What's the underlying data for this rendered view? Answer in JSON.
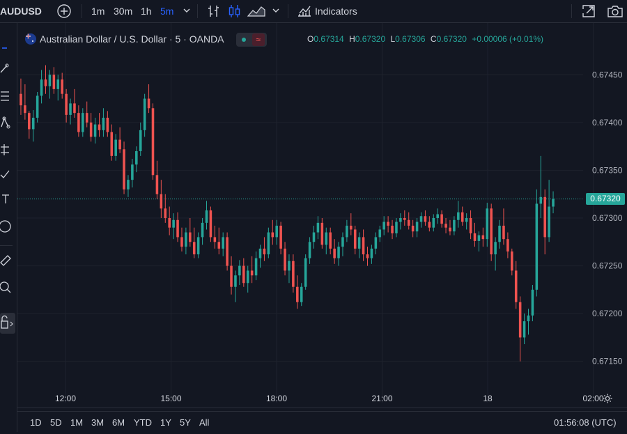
{
  "toolbar": {
    "symbol": "AUDUSD",
    "intervals": [
      "1m",
      "30m",
      "1h",
      "5m"
    ],
    "active_interval": "5m",
    "indicators_label": "Indicators"
  },
  "legend": {
    "title": "Australian Dollar / U.S. Dollar · 5 · OANDA",
    "ohlc": {
      "o_label": "O",
      "o": "0.67314",
      "h_label": "H",
      "h": "0.67320",
      "l_label": "L",
      "l": "0.67306",
      "c_label": "C",
      "c": "0.67320",
      "change": "+0.00006 (+0.01%)"
    }
  },
  "bottom": {
    "ranges": [
      "1D",
      "5D",
      "1M",
      "3M",
      "6M",
      "YTD",
      "1Y",
      "5Y",
      "All"
    ],
    "clock": "01:56:08 (UTC)"
  },
  "colors": {
    "up": "#26a69a",
    "down": "#ef5350",
    "bg": "#131722",
    "grid": "#1e222d",
    "accent": "#2962ff"
  },
  "chart_data": {
    "type": "candlestick",
    "y_ticks": [
      "0.67450",
      "0.67400",
      "0.67350",
      "0.67300",
      "0.67250",
      "0.67200",
      "0.67150"
    ],
    "y_range": [
      0.67125,
      0.67475
    ],
    "x_ticks": [
      "12:00",
      "15:00",
      "18:00",
      "21:00",
      "18",
      "02:00"
    ],
    "last_price": "0.67320",
    "last_price_value": 0.6732,
    "candles": [
      [
        0.6743,
        0.67446,
        0.67408,
        0.67418
      ],
      [
        0.67418,
        0.6744,
        0.67403,
        0.6741
      ],
      [
        0.6741,
        0.67412,
        0.67383,
        0.67393
      ],
      [
        0.67393,
        0.67413,
        0.6738,
        0.67405
      ],
      [
        0.67405,
        0.67432,
        0.674,
        0.67428
      ],
      [
        0.67428,
        0.67455,
        0.6742,
        0.67445
      ],
      [
        0.67445,
        0.6746,
        0.6743,
        0.67438
      ],
      [
        0.67438,
        0.67455,
        0.67425,
        0.6745
      ],
      [
        0.6745,
        0.67458,
        0.6743,
        0.67435
      ],
      [
        0.67435,
        0.6745,
        0.67423,
        0.67445
      ],
      [
        0.67445,
        0.67452,
        0.67425,
        0.6743
      ],
      [
        0.6743,
        0.67435,
        0.674,
        0.67408
      ],
      [
        0.67408,
        0.67425,
        0.67398,
        0.6742
      ],
      [
        0.6742,
        0.67435,
        0.67405,
        0.6741
      ],
      [
        0.6741,
        0.67418,
        0.67385,
        0.6739
      ],
      [
        0.6739,
        0.67415,
        0.67385,
        0.6741
      ],
      [
        0.6741,
        0.67422,
        0.67395,
        0.674
      ],
      [
        0.674,
        0.6741,
        0.6738,
        0.67385
      ],
      [
        0.67385,
        0.67405,
        0.67378,
        0.67398
      ],
      [
        0.67398,
        0.6741,
        0.67385,
        0.67392
      ],
      [
        0.67392,
        0.67415,
        0.67385,
        0.67405
      ],
      [
        0.67405,
        0.67412,
        0.67385,
        0.6739
      ],
      [
        0.6739,
        0.67398,
        0.6736,
        0.67365
      ],
      [
        0.67365,
        0.67388,
        0.6736,
        0.67382
      ],
      [
        0.67382,
        0.67395,
        0.67368,
        0.67372
      ],
      [
        0.67372,
        0.6738,
        0.67325,
        0.6733
      ],
      [
        0.6733,
        0.67345,
        0.67322,
        0.6734
      ],
      [
        0.6734,
        0.67362,
        0.67332,
        0.67356
      ],
      [
        0.67356,
        0.67375,
        0.67348,
        0.6737
      ],
      [
        0.6737,
        0.674,
        0.67365,
        0.67392
      ],
      [
        0.67392,
        0.6743,
        0.67385,
        0.67425
      ],
      [
        0.67425,
        0.6744,
        0.6741,
        0.67415
      ],
      [
        0.67415,
        0.6742,
        0.6734,
        0.67345
      ],
      [
        0.67345,
        0.6736,
        0.6732,
        0.67325
      ],
      [
        0.67325,
        0.6734,
        0.673,
        0.6731
      ],
      [
        0.6731,
        0.67325,
        0.67295,
        0.673
      ],
      [
        0.673,
        0.67312,
        0.67282,
        0.6729
      ],
      [
        0.6729,
        0.67305,
        0.67278,
        0.67298
      ],
      [
        0.67298,
        0.67306,
        0.67275,
        0.6728
      ],
      [
        0.6728,
        0.6729,
        0.67265,
        0.6727
      ],
      [
        0.6727,
        0.6729,
        0.67262,
        0.67285
      ],
      [
        0.67285,
        0.673,
        0.6727,
        0.67275
      ],
      [
        0.67275,
        0.6729,
        0.67258,
        0.67262
      ],
      [
        0.67262,
        0.67285,
        0.67258,
        0.6728
      ],
      [
        0.6728,
        0.673,
        0.67272,
        0.67295
      ],
      [
        0.67295,
        0.67318,
        0.67288,
        0.67308
      ],
      [
        0.67308,
        0.67312,
        0.67275,
        0.6728
      ],
      [
        0.6728,
        0.67292,
        0.67268,
        0.67275
      ],
      [
        0.67275,
        0.6729,
        0.67262,
        0.67268
      ],
      [
        0.67268,
        0.67285,
        0.6726,
        0.6728
      ],
      [
        0.6728,
        0.67285,
        0.67245,
        0.6725
      ],
      [
        0.6725,
        0.6726,
        0.6722,
        0.67228
      ],
      [
        0.67228,
        0.67245,
        0.67212,
        0.6724
      ],
      [
        0.6724,
        0.67256,
        0.6723,
        0.6725
      ],
      [
        0.6725,
        0.67258,
        0.67228,
        0.67232
      ],
      [
        0.67232,
        0.6725,
        0.67222,
        0.67245
      ],
      [
        0.67245,
        0.6726,
        0.67232,
        0.6724
      ],
      [
        0.6724,
        0.67265,
        0.67235,
        0.67258
      ],
      [
        0.67258,
        0.67272,
        0.67248,
        0.67268
      ],
      [
        0.67268,
        0.6728,
        0.67255,
        0.67262
      ],
      [
        0.67262,
        0.6729,
        0.67258,
        0.67285
      ],
      [
        0.67285,
        0.67298,
        0.67272,
        0.6728
      ],
      [
        0.6728,
        0.67298,
        0.67272,
        0.67292
      ],
      [
        0.67292,
        0.67296,
        0.67262,
        0.67268
      ],
      [
        0.67268,
        0.67275,
        0.6724,
        0.67245
      ],
      [
        0.67245,
        0.67262,
        0.67232,
        0.67255
      ],
      [
        0.67255,
        0.67262,
        0.67222,
        0.67228
      ],
      [
        0.67228,
        0.6724,
        0.67205,
        0.67212
      ],
      [
        0.67212,
        0.67232,
        0.67208,
        0.67228
      ],
      [
        0.67228,
        0.67262,
        0.67225,
        0.67258
      ],
      [
        0.67258,
        0.6728,
        0.67252,
        0.67275
      ],
      [
        0.67275,
        0.67292,
        0.67268,
        0.67285
      ],
      [
        0.67285,
        0.67302,
        0.67278,
        0.67295
      ],
      [
        0.67295,
        0.673,
        0.67268,
        0.67272
      ],
      [
        0.67272,
        0.6729,
        0.67262,
        0.67285
      ],
      [
        0.67285,
        0.6729,
        0.67262,
        0.67268
      ],
      [
        0.67268,
        0.67278,
        0.67252,
        0.67258
      ],
      [
        0.67258,
        0.67275,
        0.6725,
        0.6727
      ],
      [
        0.6727,
        0.67285,
        0.6726,
        0.6728
      ],
      [
        0.6728,
        0.67298,
        0.67275,
        0.67292
      ],
      [
        0.67292,
        0.67305,
        0.67282,
        0.67288
      ],
      [
        0.67288,
        0.67292,
        0.67262,
        0.67268
      ],
      [
        0.67268,
        0.67285,
        0.67258,
        0.6728
      ],
      [
        0.6728,
        0.67288,
        0.67255,
        0.67262
      ],
      [
        0.67262,
        0.6727,
        0.6725,
        0.67258
      ],
      [
        0.67258,
        0.67272,
        0.67252,
        0.67268
      ],
      [
        0.67268,
        0.67285,
        0.67262,
        0.6728
      ],
      [
        0.6728,
        0.67292,
        0.67275,
        0.67288
      ],
      [
        0.67288,
        0.67302,
        0.67282,
        0.67296
      ],
      [
        0.67296,
        0.67302,
        0.67285,
        0.67292
      ],
      [
        0.67292,
        0.67298,
        0.67278,
        0.67284
      ],
      [
        0.67284,
        0.673,
        0.6728,
        0.67296
      ],
      [
        0.67296,
        0.67305,
        0.67288,
        0.673
      ],
      [
        0.673,
        0.67308,
        0.67292,
        0.67298
      ],
      [
        0.67298,
        0.67306,
        0.67288,
        0.67292
      ],
      [
        0.67292,
        0.67298,
        0.6728,
        0.67286
      ],
      [
        0.67286,
        0.673,
        0.6728,
        0.67296
      ],
      [
        0.67296,
        0.67306,
        0.6729,
        0.67302
      ],
      [
        0.67302,
        0.67308,
        0.67292,
        0.67296
      ],
      [
        0.67296,
        0.67302,
        0.67286,
        0.6729
      ],
      [
        0.6729,
        0.67304,
        0.67286,
        0.673
      ],
      [
        0.673,
        0.6731,
        0.67294,
        0.67304
      ],
      [
        0.67304,
        0.67308,
        0.6729,
        0.67294
      ],
      [
        0.67294,
        0.673,
        0.67284,
        0.6729
      ],
      [
        0.6729,
        0.67298,
        0.67282,
        0.67286
      ],
      [
        0.67286,
        0.67302,
        0.67282,
        0.67298
      ],
      [
        0.67298,
        0.67318,
        0.6729,
        0.67306
      ],
      [
        0.67306,
        0.67312,
        0.67292,
        0.67296
      ],
      [
        0.67296,
        0.67305,
        0.67288,
        0.673
      ],
      [
        0.673,
        0.67308,
        0.67278,
        0.67284
      ],
      [
        0.67284,
        0.67295,
        0.6727,
        0.67276
      ],
      [
        0.67276,
        0.67286,
        0.67265,
        0.67282
      ],
      [
        0.67282,
        0.6729,
        0.6727,
        0.67278
      ],
      [
        0.67278,
        0.67316,
        0.6727,
        0.6731
      ],
      [
        0.6731,
        0.67315,
        0.67255,
        0.67262
      ],
      [
        0.67262,
        0.6728,
        0.67245,
        0.67275
      ],
      [
        0.67275,
        0.67298,
        0.67268,
        0.67292
      ],
      [
        0.67292,
        0.6731,
        0.67272,
        0.67278
      ],
      [
        0.67278,
        0.67285,
        0.67258,
        0.67265
      ],
      [
        0.67265,
        0.67268,
        0.6724,
        0.67245
      ],
      [
        0.67245,
        0.67255,
        0.67205,
        0.67212
      ],
      [
        0.67212,
        0.67218,
        0.6715,
        0.67175
      ],
      [
        0.67175,
        0.672,
        0.67168,
        0.67192
      ],
      [
        0.67192,
        0.67205,
        0.67178,
        0.67198
      ],
      [
        0.67198,
        0.6723,
        0.67192,
        0.67225
      ],
      [
        0.67225,
        0.6733,
        0.67218,
        0.67315
      ],
      [
        0.67315,
        0.67365,
        0.673,
        0.67322
      ],
      [
        0.67322,
        0.6733,
        0.67262,
        0.6728
      ],
      [
        0.6728,
        0.6734,
        0.67275,
        0.67312
      ],
      [
        0.67312,
        0.67328,
        0.67305,
        0.6732
      ]
    ]
  }
}
